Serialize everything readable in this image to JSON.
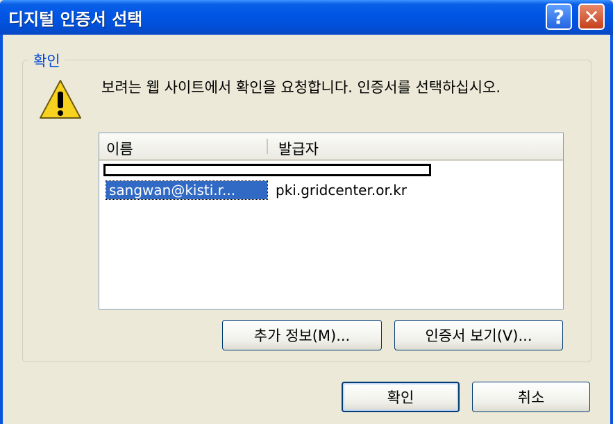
{
  "window": {
    "title": "디지털 인증서 선택",
    "help_label": "?",
    "close_label": "✕"
  },
  "group": {
    "label": "확인"
  },
  "message": "보려는 웹 사이트에서 확인을 요청합니다. 인증서를 선택하십시오.",
  "list": {
    "columns": [
      "이름",
      "발급자"
    ],
    "rows": [
      {
        "name": "sangwan@kisti.r...",
        "issuer": "pki.gridcenter.or.kr",
        "selected": true
      }
    ]
  },
  "buttons": {
    "more_info": "추가 정보(M)...",
    "view_cert": "인증서 보기(V)...",
    "ok": "확인",
    "cancel": "취소"
  },
  "colors": {
    "titlebar": "#0055e5",
    "selection": "#316ac5",
    "group_label": "#0046d5",
    "dialog_bg": "#ece9d8"
  },
  "icons": {
    "warning": "warning-icon",
    "help": "help-icon",
    "close": "close-icon"
  }
}
